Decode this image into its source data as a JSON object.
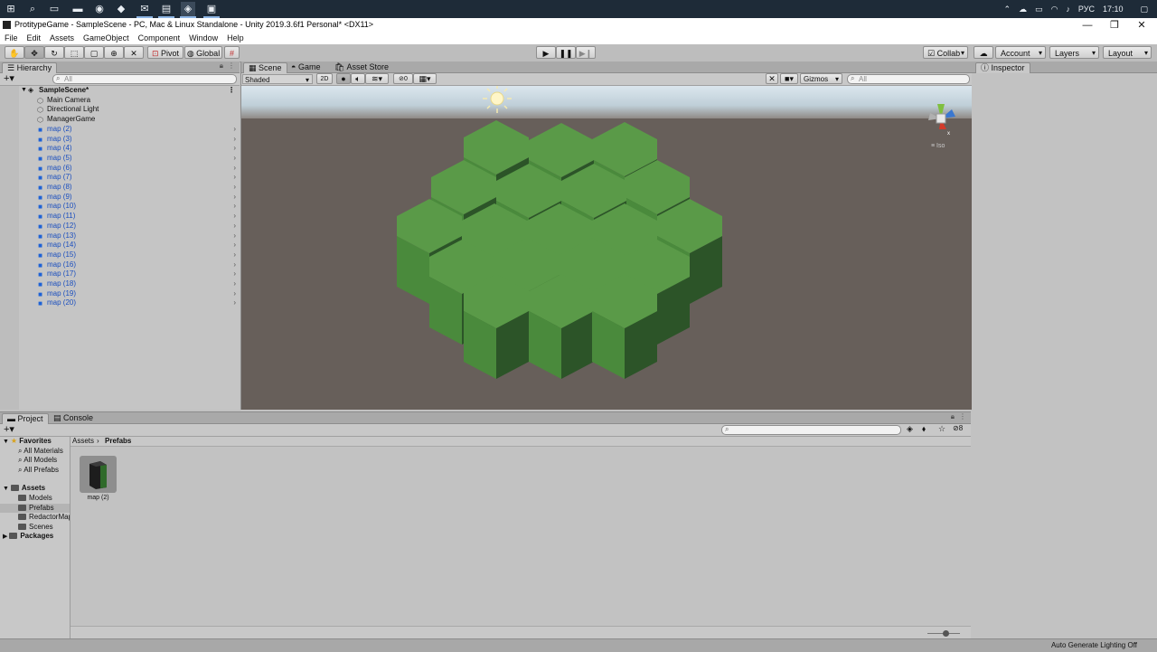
{
  "window": {
    "title": "ProtitypeGame - SampleScene - PC, Mac & Linux Standalone - Unity 2019.3.6f1 Personal* <DX11>"
  },
  "taskbar": {
    "tray": {
      "language": "РУС",
      "time": "17:10"
    }
  },
  "menu": [
    "File",
    "Edit",
    "Assets",
    "GameObject",
    "Component",
    "Window",
    "Help"
  ],
  "toolbar": {
    "pivot_label": "Pivot",
    "global_label": "Global",
    "collab_label": "Collab",
    "account_label": "Account",
    "layers_label": "Layers",
    "layout_label": "Layout"
  },
  "hierarchy": {
    "tab_label": "Hierarchy",
    "search_placeholder": "All",
    "scene_name": "SampleScene*",
    "items": [
      {
        "label": "Main Camera",
        "kind": "gameobject"
      },
      {
        "label": "Directional Light",
        "kind": "gameobject"
      },
      {
        "label": "ManagerGame",
        "kind": "gameobject"
      },
      {
        "label": "map (2)",
        "kind": "prefab"
      },
      {
        "label": "map (3)",
        "kind": "prefab"
      },
      {
        "label": "map (4)",
        "kind": "prefab"
      },
      {
        "label": "map (5)",
        "kind": "prefab"
      },
      {
        "label": "map (6)",
        "kind": "prefab"
      },
      {
        "label": "map (7)",
        "kind": "prefab"
      },
      {
        "label": "map (8)",
        "kind": "prefab"
      },
      {
        "label": "map (9)",
        "kind": "prefab"
      },
      {
        "label": "map (10)",
        "kind": "prefab"
      },
      {
        "label": "map (11)",
        "kind": "prefab"
      },
      {
        "label": "map (12)",
        "kind": "prefab"
      },
      {
        "label": "map (13)",
        "kind": "prefab"
      },
      {
        "label": "map (14)",
        "kind": "prefab"
      },
      {
        "label": "map (15)",
        "kind": "prefab"
      },
      {
        "label": "map (16)",
        "kind": "prefab"
      },
      {
        "label": "map (17)",
        "kind": "prefab"
      },
      {
        "label": "map (18)",
        "kind": "prefab"
      },
      {
        "label": "map (19)",
        "kind": "prefab"
      },
      {
        "label": "map (20)",
        "kind": "prefab"
      }
    ]
  },
  "scene": {
    "tabs": [
      "Scene",
      "Game",
      "Asset Store"
    ],
    "shading_mode": "Shaded",
    "mode_2d_label": "2D",
    "hidden_count": "0",
    "gizmos_label": "Gizmos",
    "search_placeholder": "All",
    "projection_label": "Iso",
    "colors": {
      "hex_top": "#5a9a48",
      "hex_side_light": "#4a8a3c",
      "hex_side_dark": "#2c5428",
      "ground": "#675f5a"
    }
  },
  "inspector": {
    "tab_label": "Inspector"
  },
  "project": {
    "tabs": [
      "Project",
      "Console"
    ],
    "favorites_label": "Favorites",
    "favorites": [
      "All Materials",
      "All Models",
      "All Prefabs"
    ],
    "assets_label": "Assets",
    "asset_folders": [
      "Models",
      "Prefabs",
      "RedactorMap",
      "Scenes"
    ],
    "packages_label": "Packages",
    "breadcrumb": [
      "Assets",
      "Prefabs"
    ],
    "hidden_count": "8",
    "files": [
      {
        "label": "map (2)"
      }
    ]
  },
  "status": {
    "right_text": "Auto Generate Lighting Off"
  }
}
